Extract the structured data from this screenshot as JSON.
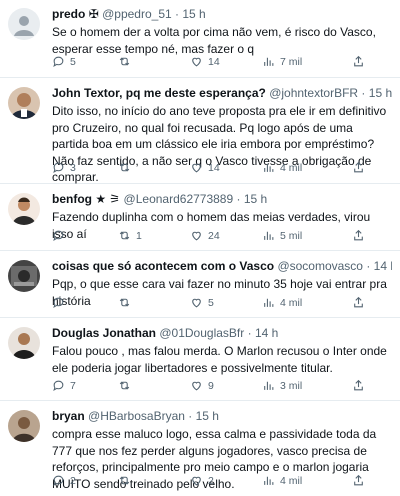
{
  "tweets": [
    {
      "name": "predo",
      "name_suffix": "✠",
      "handle": "@ppedro_51",
      "time": "15 h",
      "text": "Se o homem der a volta por cima não vem, é risco do Vasco, esperar esse tempo né, mas fazer o q",
      "replies": "5",
      "retweets": "",
      "likes": "14",
      "views": "7 mil"
    },
    {
      "name": "John Textor, pq me deste esperança?",
      "name_suffix": "",
      "handle": "@johntextorBFR",
      "time": "15 h",
      "text": "Dito isso, no início do ano teve proposta pra ele ir em definitivo pro Cruzeiro, no qual foi recusada. Pq logo após de uma partida boa em um clássico ele iria embora por empréstimo? Não faz sentido, a não ser q o Vasco tivesse a obrigação de comprar.",
      "replies": "3",
      "retweets": "",
      "likes": "14",
      "views": "4 mil"
    },
    {
      "name": "benfog",
      "name_suffix": "★ ⚞",
      "handle": "@Leonard62773889",
      "time": "15 h",
      "text": "Fazendo duplinha com o homem das meias verdades, virou isso aí",
      "replies": "",
      "retweets": "1",
      "likes": "24",
      "views": "5 mil"
    },
    {
      "name": "coisas que só acontecem com o Vasco",
      "name_suffix": "",
      "handle": "@socomovasco",
      "time": "14 h",
      "text": "Pqp, o que esse cara vai fazer no minuto 35 hoje vai entrar pra história",
      "replies": "",
      "retweets": "",
      "likes": "5",
      "views": "4 mil"
    },
    {
      "name": "Douglas Jonathan",
      "name_suffix": "",
      "handle": "@01DouglasBfr",
      "time": "14 h",
      "text": "Falou pouco , mas falou merda. O Marlon recusou o Inter onde ele poderia jogar libertadores e possivelmente titular.",
      "replies": "7",
      "retweets": "",
      "likes": "9",
      "views": "3 mil"
    },
    {
      "name": "bryan",
      "name_suffix": "",
      "handle": "@HBarbosaBryan",
      "time": "15 h",
      "text": "compra esse maluco logo, essa calma e passividade toda da 777 que nos fez perder alguns jogadores, vasco precisa de reforços, principalmente pro meio campo e o marlon jogaria MUITO sendo treinado pelo velho.",
      "replies": "2",
      "retweets": "",
      "likes": "2",
      "views": "4 mil"
    }
  ],
  "icons": {
    "reply": "reply-icon",
    "retweet": "retweet-icon",
    "like": "heart-icon",
    "views": "views-icon",
    "share": "share-icon"
  },
  "colors": {
    "text": "#0f1419",
    "muted": "#536471",
    "divider": "#e6ecf0"
  }
}
